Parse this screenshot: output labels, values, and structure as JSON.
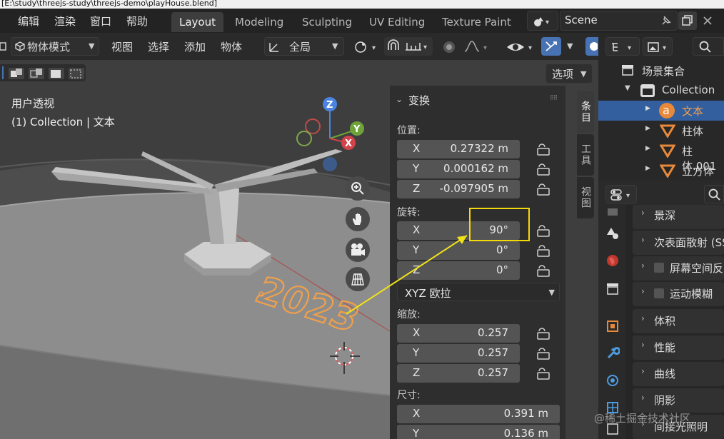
{
  "window_title": "[E:\\study\\threejs-study\\threejs-demo\\playHouse.blend]",
  "menu": [
    "编辑",
    "渲染",
    "窗口",
    "帮助"
  ],
  "workspaces": {
    "layout": "Layout",
    "modeling": "Modeling",
    "sculpting": "Sculpting",
    "uv": "UV Editing",
    "texture": "Texture Paint"
  },
  "scene_name": "Scene",
  "header": {
    "mode": "物体模式",
    "view": "视图",
    "select": "选择",
    "add": "添加",
    "object": "物体",
    "transform_orientation": "全局",
    "options": "选项"
  },
  "viewport": {
    "persp_label": "用户透视",
    "collection_label": "(1) Collection | 文本",
    "text_object": "2023"
  },
  "npanel": {
    "section": "变换",
    "location_label": "位置:",
    "location": {
      "x": "0.27322 m",
      "y": "0.000162 m",
      "z": "-0.097905 m"
    },
    "rotation_label": "旋转:",
    "rotation": {
      "x": "90°",
      "y": "0°",
      "z": "0°"
    },
    "rotation_mode": "XYZ 欧拉",
    "scale_label": "缩放:",
    "scale": {
      "x": "0.257",
      "y": "0.257",
      "z": "0.257"
    },
    "dims_label": "尺寸:",
    "dims": {
      "x": "0.391 m",
      "y": "0.136 m"
    },
    "axis": {
      "x": "X",
      "y": "Y",
      "z": "Z"
    }
  },
  "side_tabs": {
    "item": "条目",
    "tool": "工具",
    "view": "视图"
  },
  "outliner": {
    "scene_collection": "场景集合",
    "collection": "Collection",
    "items": [
      "文本",
      "柱体",
      "柱体.001",
      "立方体"
    ]
  },
  "properties": {
    "sections": [
      "景深",
      "次表面散射 (SS",
      "屏幕空间反",
      "运动模糊",
      "体积",
      "性能",
      "曲线",
      "阴影",
      "间接光照明"
    ]
  },
  "watermark": "@稀土掘金技术社区",
  "colors": {
    "accent": "#4772b3",
    "selected": "#335f9f",
    "orange": "#e8893a",
    "highlight_box": "#f5d90a",
    "arrow": "#f0e21a"
  }
}
